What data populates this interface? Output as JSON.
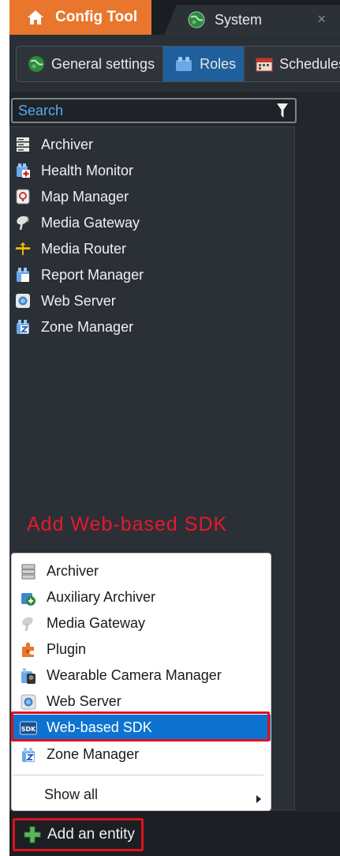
{
  "tabs": {
    "config_tool": "Config Tool",
    "system": "System",
    "close": "×"
  },
  "subtabs": [
    {
      "label": "General settings",
      "icon": "globe-icon"
    },
    {
      "label": "Roles",
      "icon": "roles-icon",
      "active": true
    },
    {
      "label": "Schedules",
      "icon": "calendar-icon"
    }
  ],
  "search": {
    "placeholder": "Search"
  },
  "roles": [
    {
      "label": "Archiver",
      "icon": "archiver-icon"
    },
    {
      "label": "Health Monitor",
      "icon": "health-monitor-icon"
    },
    {
      "label": "Map Manager",
      "icon": "map-manager-icon"
    },
    {
      "label": "Media Gateway",
      "icon": "media-gateway-icon"
    },
    {
      "label": "Media Router",
      "icon": "media-router-icon"
    },
    {
      "label": "Report Manager",
      "icon": "report-manager-icon"
    },
    {
      "label": "Web Server",
      "icon": "web-server-icon"
    },
    {
      "label": "Zone Manager",
      "icon": "zone-manager-icon"
    }
  ],
  "annotation": "Add Web-based SDK",
  "menu": {
    "items": [
      {
        "label": "Archiver",
        "icon": "archiver-icon"
      },
      {
        "label": "Auxiliary Archiver",
        "icon": "auxiliary-archiver-icon"
      },
      {
        "label": "Media Gateway",
        "icon": "media-gateway-icon"
      },
      {
        "label": "Plugin",
        "icon": "plugin-icon"
      },
      {
        "label": "Wearable Camera Manager",
        "icon": "wearable-camera-icon"
      },
      {
        "label": "Web Server",
        "icon": "web-server-icon"
      },
      {
        "label": "Web-based SDK",
        "icon": "sdk-icon",
        "selected": true
      },
      {
        "label": "Zone Manager",
        "icon": "zone-manager-icon"
      }
    ],
    "show_all": "Show all",
    "sdk_badge": "SDK"
  },
  "bottom": {
    "add_entity": "Add an entity"
  },
  "colors": {
    "accent_orange": "#e8762c",
    "selection_blue": "#0e73d0",
    "annotation_red": "#e0101e",
    "search_text_blue": "#59a9ef"
  }
}
